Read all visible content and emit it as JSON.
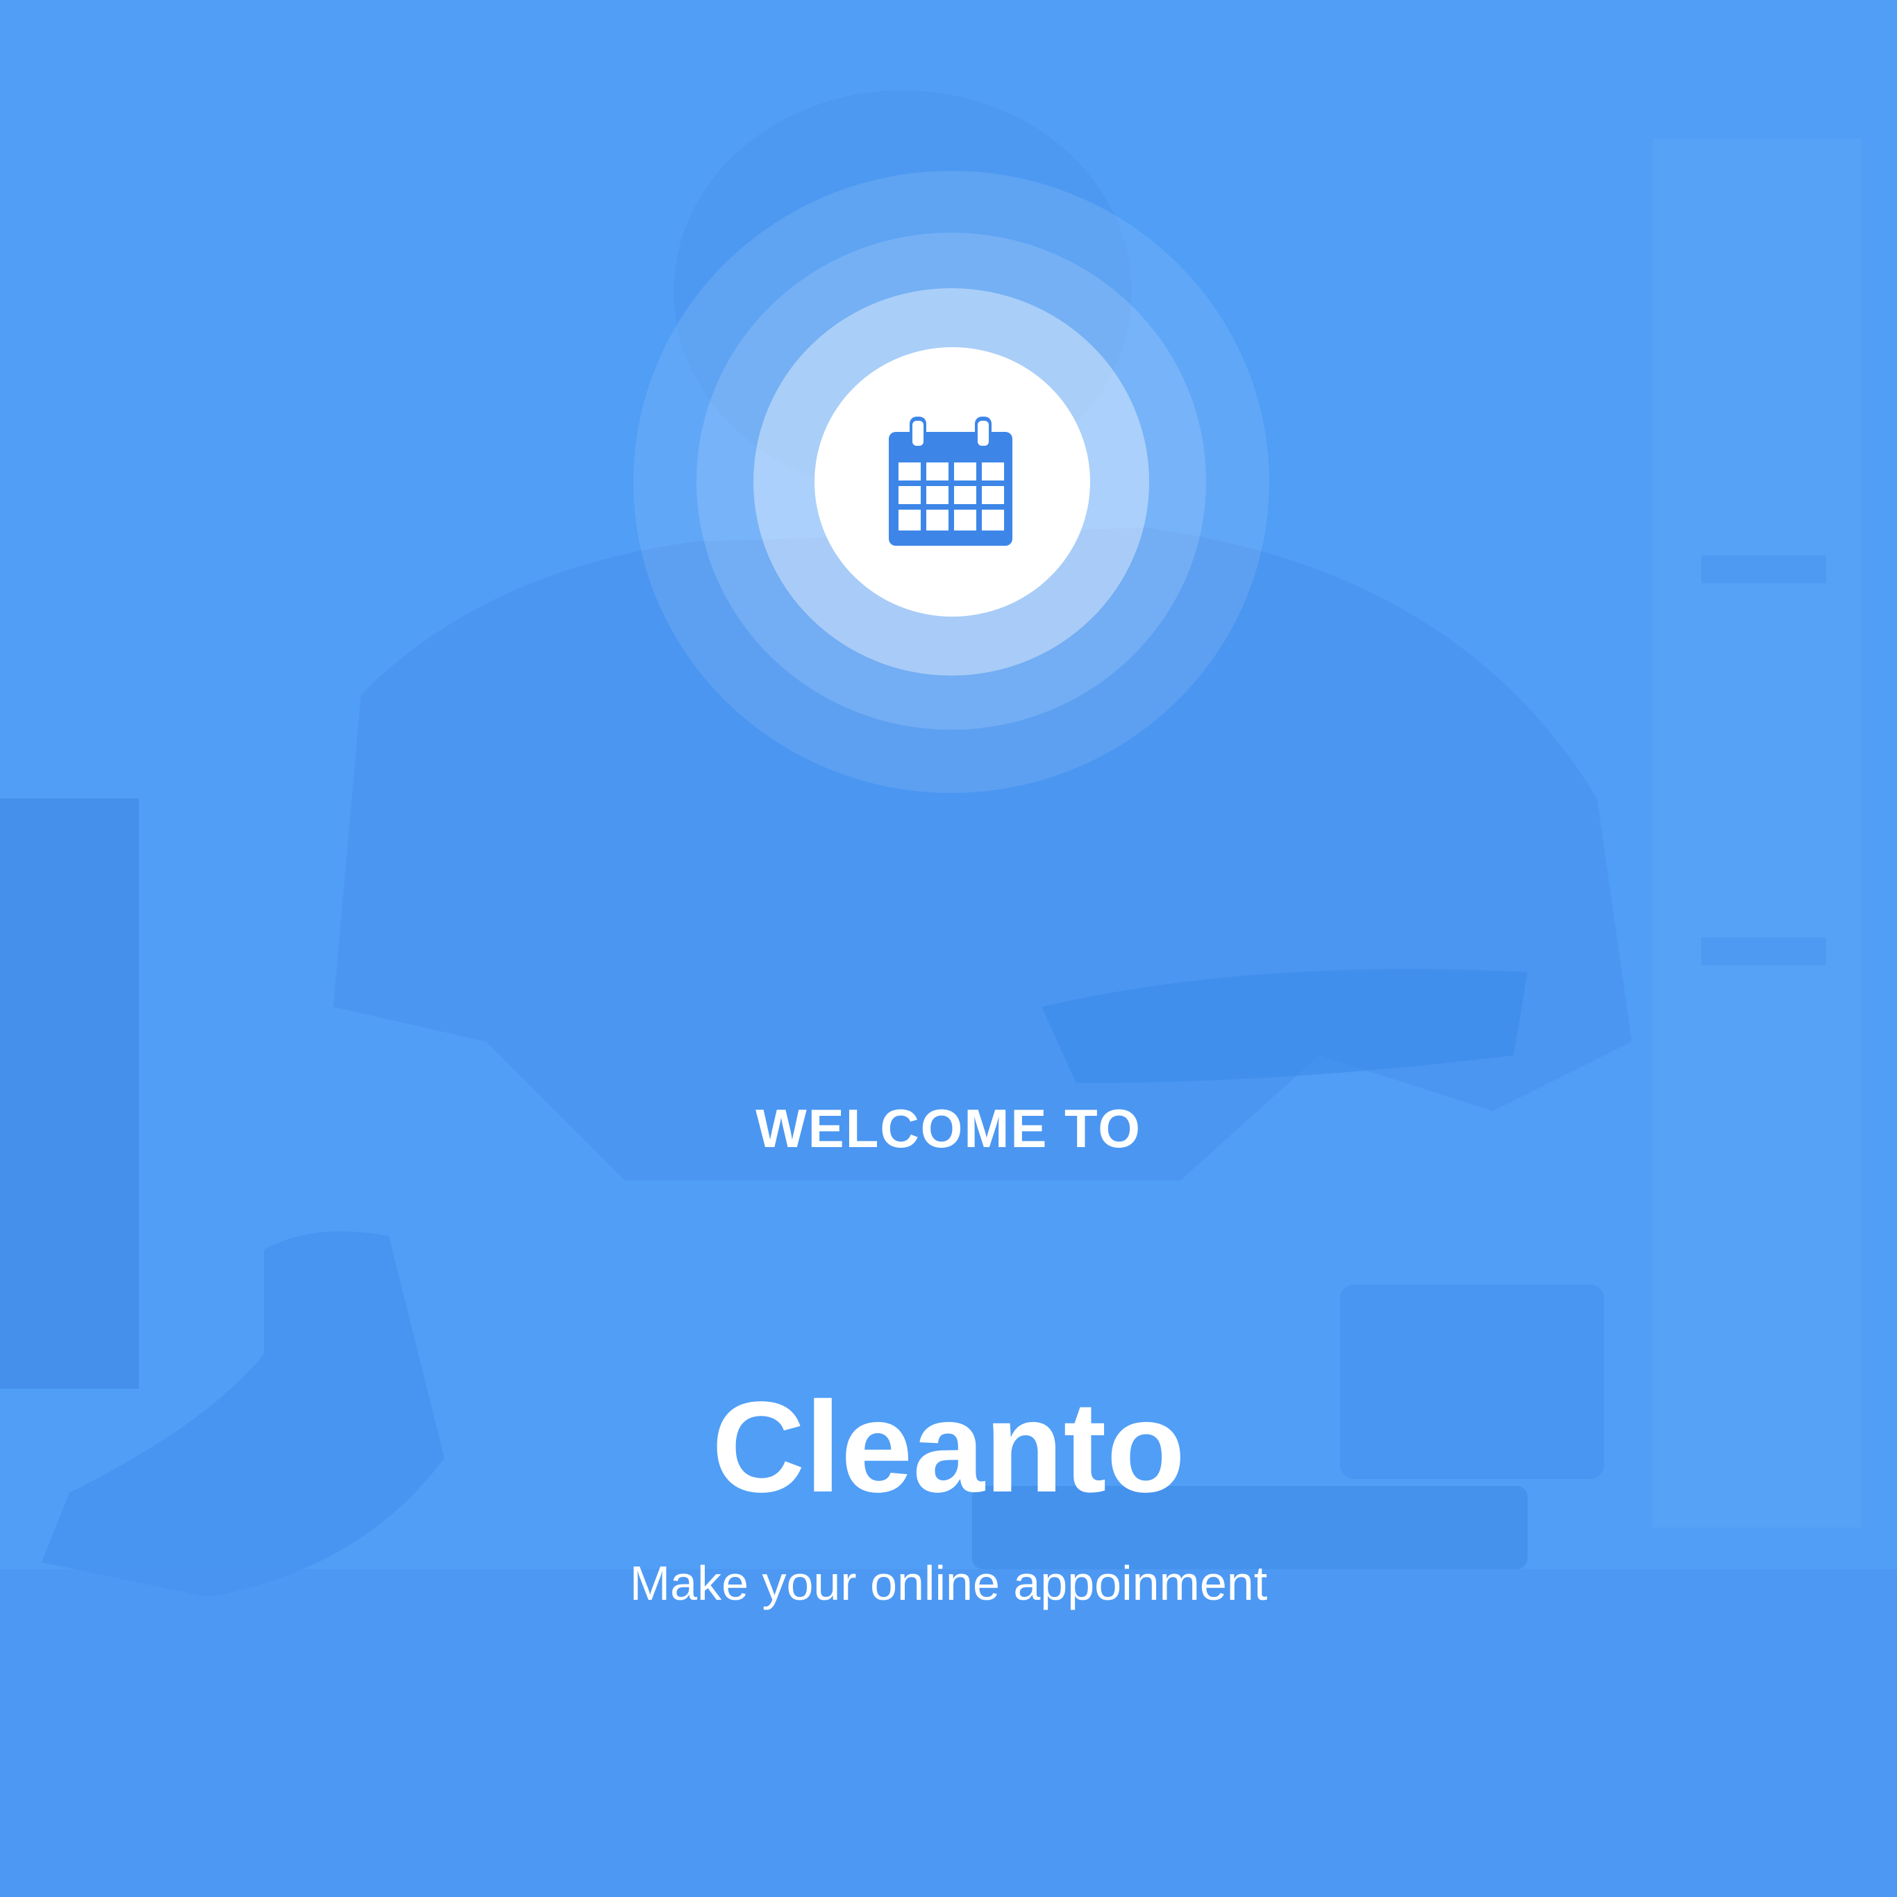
{
  "splash": {
    "welcome_text": "WELCOME TO",
    "app_name": "Cleanto",
    "tagline": "Make your online appoinment",
    "icon": "calendar-icon"
  },
  "colors": {
    "background_tint": "#4f9df5",
    "icon_color": "#3d86e8",
    "text_color": "#ffffff"
  }
}
